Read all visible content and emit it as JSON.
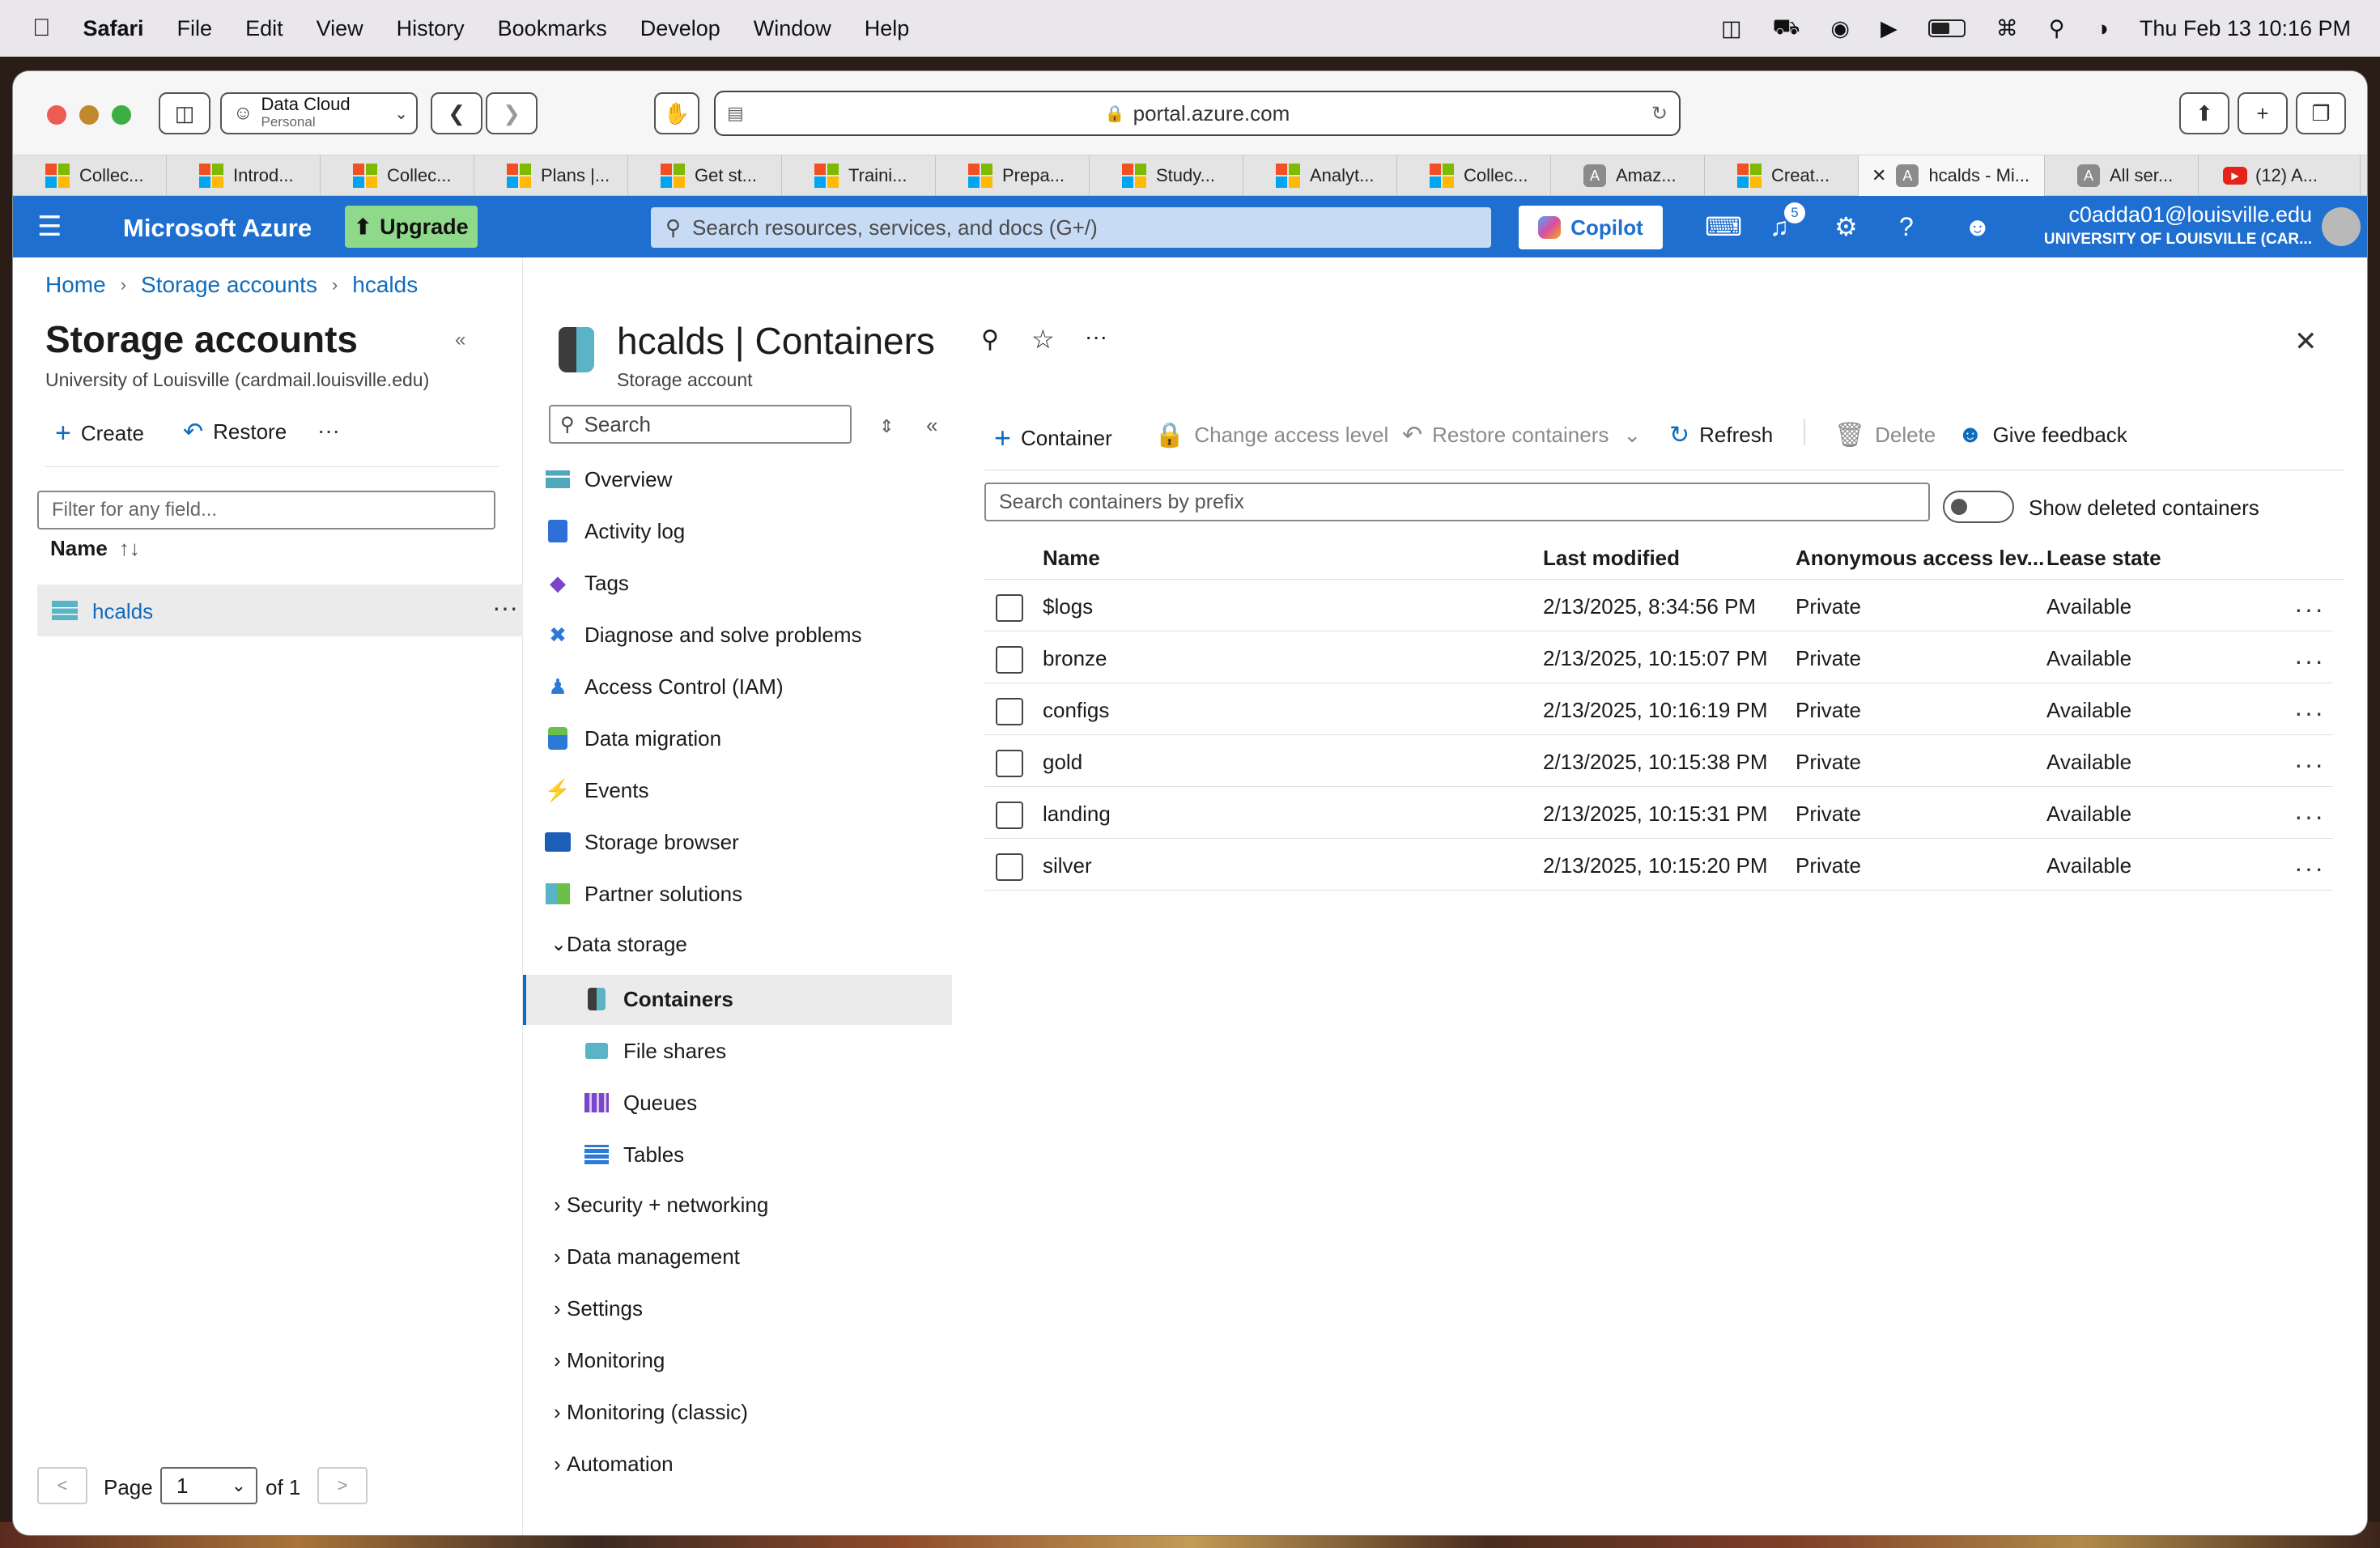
{
  "menubar": {
    "app": "Safari",
    "items": [
      "File",
      "Edit",
      "View",
      "History",
      "Bookmarks",
      "Develop",
      "Window",
      "Help"
    ],
    "datetime": "Thu Feb 13  10:16 PM"
  },
  "browser": {
    "profile": "Data Cloud",
    "profile_sub": "Personal",
    "address": "portal.azure.com",
    "tabs": [
      {
        "label": "Collec...",
        "icon": "ms"
      },
      {
        "label": "Introd...",
        "icon": "ms"
      },
      {
        "label": "Collec...",
        "icon": "ms"
      },
      {
        "label": "Plans |...",
        "icon": "ms"
      },
      {
        "label": "Get st...",
        "icon": "ms"
      },
      {
        "label": "Traini...",
        "icon": "ms"
      },
      {
        "label": "Prepa...",
        "icon": "ms"
      },
      {
        "label": "Study...",
        "icon": "ms"
      },
      {
        "label": "Analyt...",
        "icon": "ms"
      },
      {
        "label": "Collec...",
        "icon": "ms"
      },
      {
        "label": "Amaz...",
        "icon": "A"
      },
      {
        "label": "Creat...",
        "icon": "ms"
      },
      {
        "label": "hcalds - Mi...",
        "icon": "A",
        "active": true
      },
      {
        "label": "All ser...",
        "icon": "A"
      },
      {
        "label": "(12) A...",
        "icon": "yt"
      }
    ]
  },
  "azure": {
    "brand": "Microsoft Azure",
    "upgrade": "Upgrade",
    "search_placeholder": "Search resources, services, and docs (G+/)",
    "copilot": "Copilot",
    "notif_count": "5",
    "user_email": "c0adda01@louisville.edu",
    "user_org": "UNIVERSITY OF LOUISVILLE (CAR..."
  },
  "breadcrumb": [
    "Home",
    "Storage accounts",
    "hcalds"
  ],
  "left_pane": {
    "title": "Storage accounts",
    "subtitle": "University of Louisville (cardmail.louisville.edu)",
    "create": "Create",
    "restore": "Restore",
    "filter_placeholder": "Filter for any field...",
    "col_name": "Name",
    "items": [
      "hcalds"
    ],
    "page_label": "Page",
    "page_value": "1",
    "page_of": "of 1"
  },
  "blade": {
    "title": "hcalds | Containers",
    "subtitle": "Storage account",
    "nav_search_placeholder": "Search",
    "nav": [
      {
        "label": "Overview",
        "icon": "overview-icon"
      },
      {
        "label": "Activity log",
        "icon": "activity-log-icon"
      },
      {
        "label": "Tags",
        "icon": "tag-icon"
      },
      {
        "label": "Diagnose and solve problems",
        "icon": "wrench-icon"
      },
      {
        "label": "Access Control (IAM)",
        "icon": "people-icon"
      },
      {
        "label": "Data migration",
        "icon": "migration-icon"
      },
      {
        "label": "Events",
        "icon": "lightning-icon"
      },
      {
        "label": "Storage browser",
        "icon": "storage-browser-icon"
      },
      {
        "label": "Partner solutions",
        "icon": "partner-icon"
      }
    ],
    "data_storage": "Data storage",
    "data_storage_items": [
      {
        "label": "Containers",
        "icon": "container-icon"
      },
      {
        "label": "File shares",
        "icon": "file-share-icon"
      },
      {
        "label": "Queues",
        "icon": "queue-icon"
      },
      {
        "label": "Tables",
        "icon": "table-icon"
      }
    ],
    "groups": [
      "Security + networking",
      "Data management",
      "Settings",
      "Monitoring",
      "Monitoring (classic)",
      "Automation"
    ]
  },
  "commands": {
    "container": "Container",
    "change_access": "Change access level",
    "restore": "Restore containers",
    "refresh": "Refresh",
    "delete": "Delete",
    "feedback": "Give feedback"
  },
  "container_search_placeholder": "Search containers by prefix",
  "show_deleted": "Show deleted containers",
  "table": {
    "headers": [
      "Name",
      "Last modified",
      "Anonymous access lev...",
      "Lease state"
    ],
    "rows": [
      {
        "name": "$logs",
        "modified": "2/13/2025, 8:34:56 PM",
        "access": "Private",
        "lease": "Available"
      },
      {
        "name": "bronze",
        "modified": "2/13/2025, 10:15:07 PM",
        "access": "Private",
        "lease": "Available"
      },
      {
        "name": "configs",
        "modified": "2/13/2025, 10:16:19 PM",
        "access": "Private",
        "lease": "Available"
      },
      {
        "name": "gold",
        "modified": "2/13/2025, 10:15:38 PM",
        "access": "Private",
        "lease": "Available"
      },
      {
        "name": "landing",
        "modified": "2/13/2025, 10:15:31 PM",
        "access": "Private",
        "lease": "Available"
      },
      {
        "name": "silver",
        "modified": "2/13/2025, 10:15:20 PM",
        "access": "Private",
        "lease": "Available"
      }
    ]
  }
}
